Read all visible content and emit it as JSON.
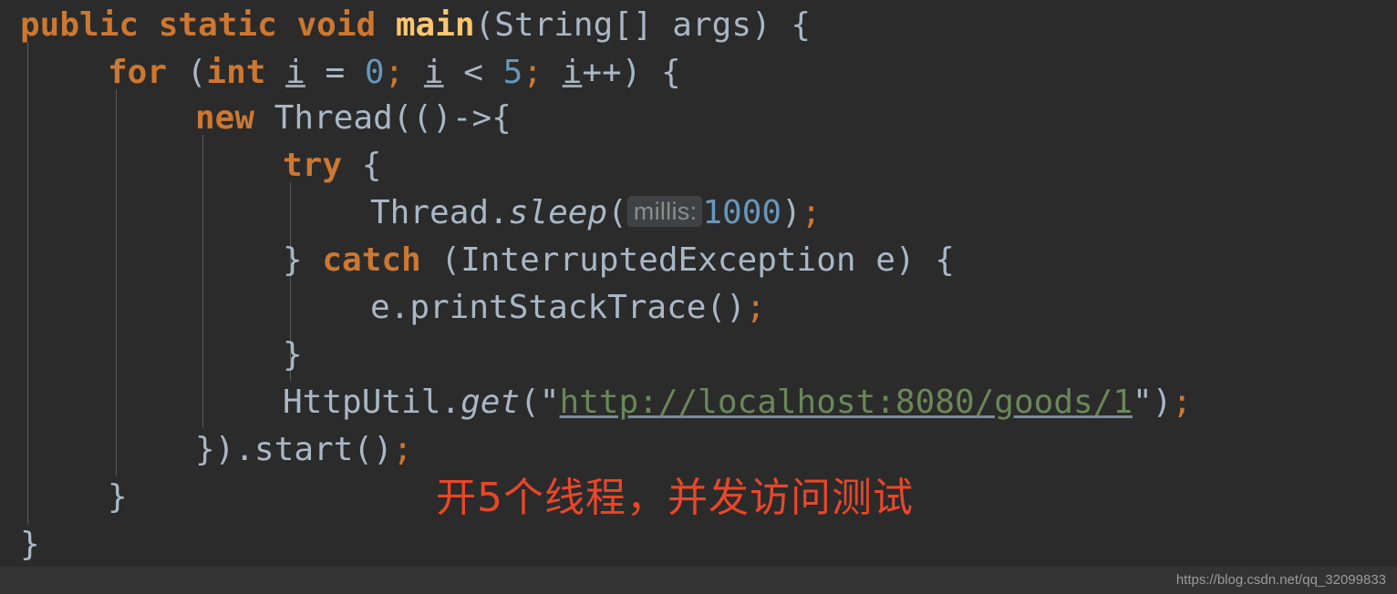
{
  "editor": {
    "theme": "darcula",
    "background_color": "#2b2b2b",
    "language": "Java",
    "colors": {
      "keyword": "#cc7832",
      "method_declaration": "#ffc66d",
      "number": "#6897bb",
      "string_url": "#6a8759",
      "default_text": "#a9b7c6",
      "indent_guide": "#585858",
      "param_hint_bg": "#3f4244",
      "param_hint_text": "#8c8c8c",
      "annotation": "#e8472a",
      "watermark_bar": "#333333"
    },
    "lines": [
      {
        "n": 1,
        "indent": 0,
        "text": "public static void main(String[] args) {",
        "tokens": [
          {
            "t": "public",
            "k": "kw-b"
          },
          {
            "t": " ",
            "k": "plain"
          },
          {
            "t": "static",
            "k": "kw-b"
          },
          {
            "t": " ",
            "k": "plain"
          },
          {
            "t": "void",
            "k": "kw-b"
          },
          {
            "t": " ",
            "k": "plain"
          },
          {
            "t": "main",
            "k": "mdecl"
          },
          {
            "t": "(String[] args) {",
            "k": "plain"
          }
        ]
      },
      {
        "n": 2,
        "indent": 1,
        "text": "for (int i = 0; i < 5; i++) {",
        "tokens": [
          {
            "t": "for",
            "k": "kw-b"
          },
          {
            "t": " (",
            "k": "plain"
          },
          {
            "t": "int",
            "k": "kw-b"
          },
          {
            "t": " ",
            "k": "plain"
          },
          {
            "t": "i",
            "k": "var-u"
          },
          {
            "t": " = ",
            "k": "plain"
          },
          {
            "t": "0",
            "k": "num"
          },
          {
            "t": ";",
            "k": "semi"
          },
          {
            "t": " ",
            "k": "plain"
          },
          {
            "t": "i",
            "k": "var-u"
          },
          {
            "t": " < ",
            "k": "plain"
          },
          {
            "t": "5",
            "k": "num"
          },
          {
            "t": ";",
            "k": "semi"
          },
          {
            "t": " ",
            "k": "plain"
          },
          {
            "t": "i",
            "k": "var-u"
          },
          {
            "t": "++) {",
            "k": "plain"
          }
        ]
      },
      {
        "n": 3,
        "indent": 2,
        "text": "new Thread(()->{",
        "tokens": [
          {
            "t": "new",
            "k": "kw-b"
          },
          {
            "t": " Thread(()->{",
            "k": "plain"
          }
        ]
      },
      {
        "n": 4,
        "indent": 3,
        "text": "try {",
        "tokens": [
          {
            "t": "try",
            "k": "kw-b"
          },
          {
            "t": " {",
            "k": "plain"
          }
        ]
      },
      {
        "n": 5,
        "indent": 4,
        "text": "Thread.sleep( millis: 1000);",
        "param_hint": "millis:",
        "tokens": [
          {
            "t": "Thread.",
            "k": "plain"
          },
          {
            "t": "sleep",
            "k": "mcall"
          },
          {
            "t": "(",
            "k": "plain"
          },
          {
            "t": "millis:",
            "k": "hint"
          },
          {
            "t": "1000",
            "k": "num"
          },
          {
            "t": ")",
            "k": "plain"
          },
          {
            "t": ";",
            "k": "semi"
          }
        ]
      },
      {
        "n": 6,
        "indent": 3,
        "text": "} catch (InterruptedException e) {",
        "tokens": [
          {
            "t": "} ",
            "k": "plain"
          },
          {
            "t": "catch",
            "k": "kw-b"
          },
          {
            "t": " (InterruptedException e) {",
            "k": "plain"
          }
        ]
      },
      {
        "n": 7,
        "indent": 4,
        "text": "e.printStackTrace();",
        "tokens": [
          {
            "t": "e.printStackTrace()",
            "k": "plain"
          },
          {
            "t": ";",
            "k": "semi"
          }
        ]
      },
      {
        "n": 8,
        "indent": 3,
        "text": "}",
        "tokens": [
          {
            "t": "}",
            "k": "plain"
          }
        ]
      },
      {
        "n": 9,
        "indent": 3,
        "text": "HttpUtil.get(\"http://localhost:8080/goods/1\");",
        "url": "http://localhost:8080/goods/1",
        "tokens": [
          {
            "t": "HttpUtil.",
            "k": "plain"
          },
          {
            "t": "get",
            "k": "mcall"
          },
          {
            "t": "(\"",
            "k": "plain"
          },
          {
            "t": "http://localhost:8080/goods/1",
            "k": "url"
          },
          {
            "t": "\")",
            "k": "plain"
          },
          {
            "t": ";",
            "k": "semi"
          }
        ]
      },
      {
        "n": 10,
        "indent": 2,
        "text": "}).start();",
        "tokens": [
          {
            "t": "}).start()",
            "k": "plain"
          },
          {
            "t": ";",
            "k": "semi"
          }
        ]
      },
      {
        "n": 11,
        "indent": 1,
        "text": "}",
        "tokens": [
          {
            "t": "}",
            "k": "plain"
          }
        ]
      },
      {
        "n": 12,
        "indent": 0,
        "text": "}",
        "tokens": [
          {
            "t": "}",
            "k": "plain"
          }
        ]
      }
    ]
  },
  "annotation": {
    "text": "开5个线程，并发访问测试",
    "color": "#e8472a"
  },
  "watermark": {
    "text": "https://blog.csdn.net/qq_32099833"
  }
}
